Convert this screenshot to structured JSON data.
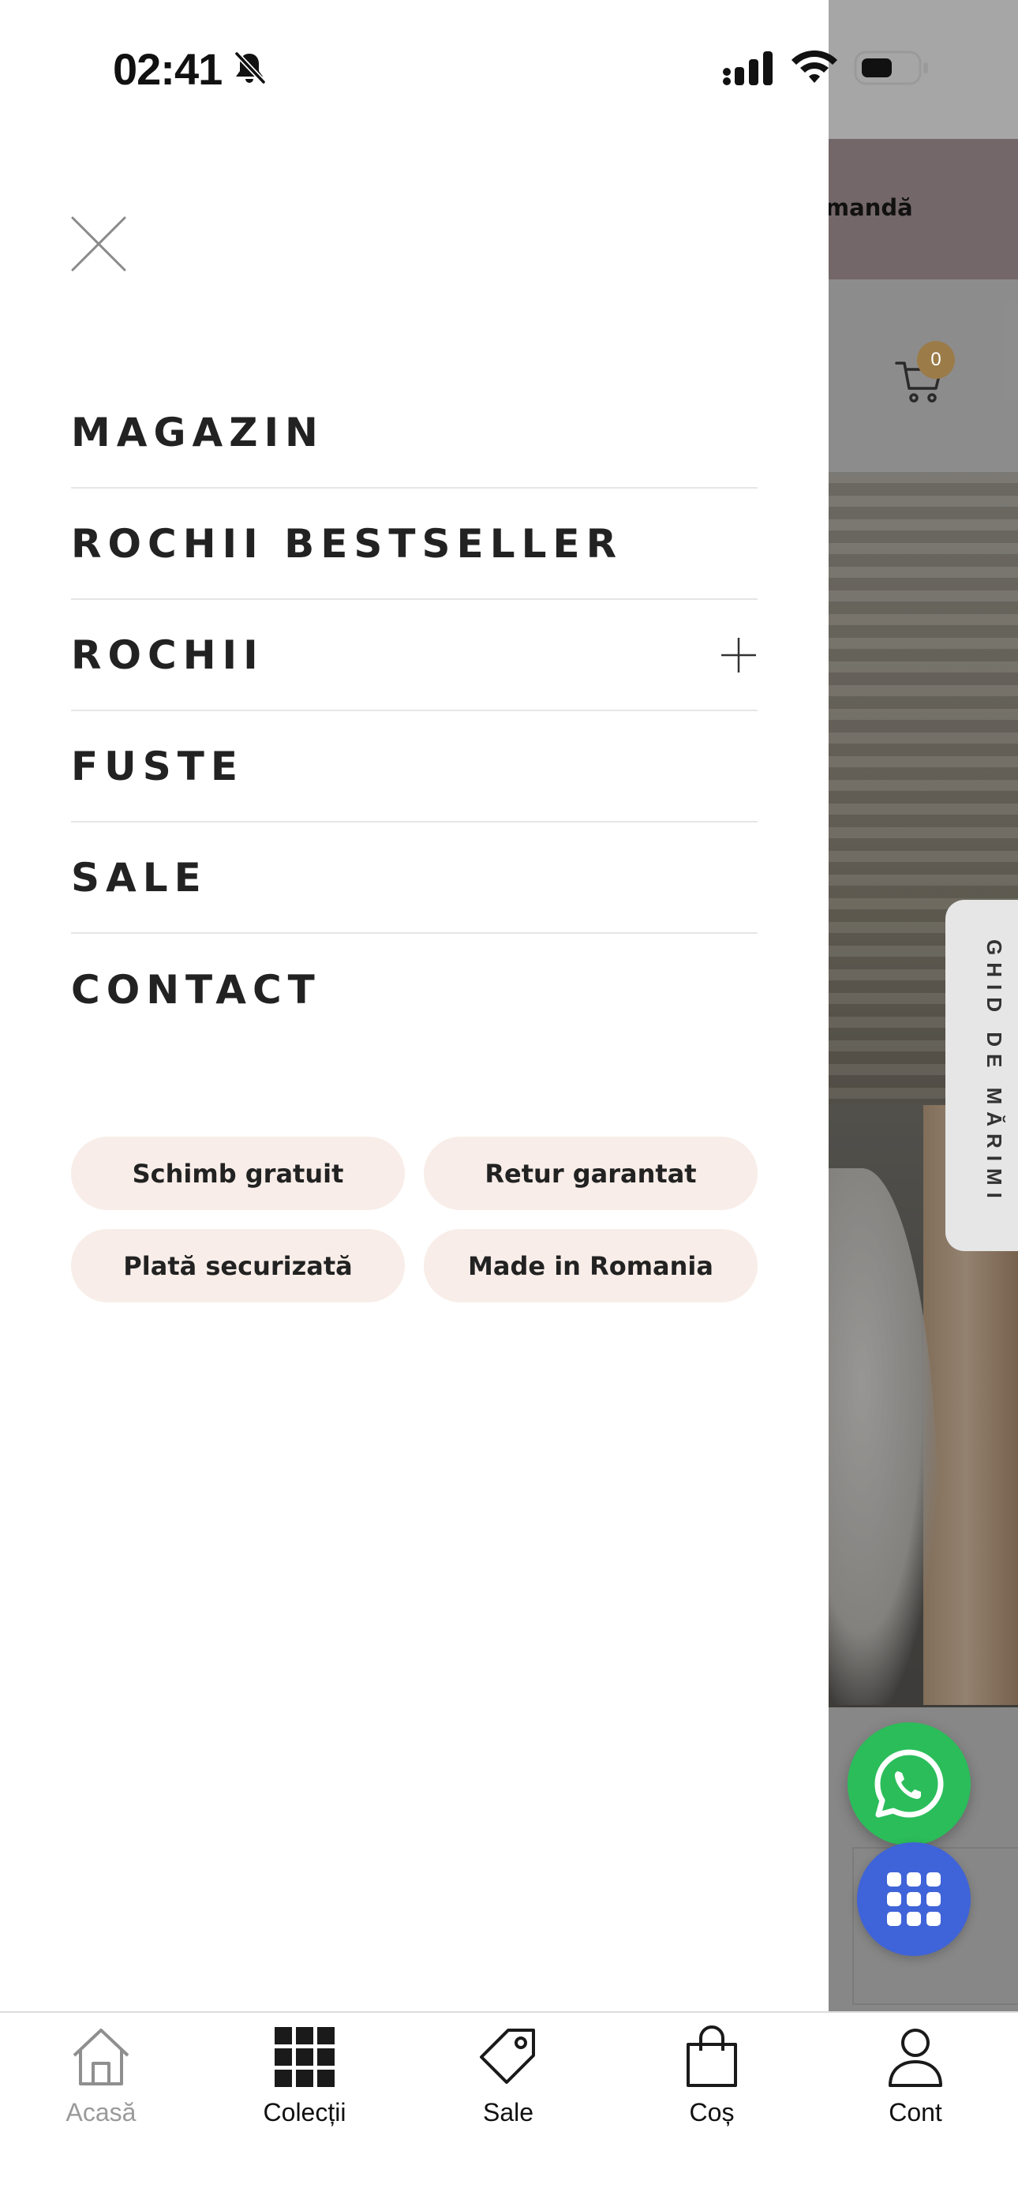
{
  "status_bar": {
    "time": "02:41"
  },
  "background": {
    "announcement_partial": "omandă",
    "cart_count": "0",
    "size_guide_label": "GHID DE MĂRIMI"
  },
  "menu": {
    "items": [
      {
        "label": "MAGAZIN"
      },
      {
        "label": "ROCHII BESTSELLER"
      },
      {
        "label": "ROCHII",
        "expandable": true
      },
      {
        "label": "FUSTE"
      },
      {
        "label": "SALE"
      },
      {
        "label": "CONTACT"
      }
    ],
    "badges": [
      "Schimb gratuit",
      "Retur garantat",
      "Plată securizată",
      "Made in Romania"
    ]
  },
  "tabbar": {
    "items": [
      {
        "label": "Acasă",
        "icon": "home-icon",
        "active": false
      },
      {
        "label": "Colecții",
        "icon": "grid-icon",
        "active": true
      },
      {
        "label": "Sale",
        "icon": "tag-icon",
        "active": true
      },
      {
        "label": "Coș",
        "icon": "bag-icon",
        "active": true
      },
      {
        "label": "Cont",
        "icon": "user-icon",
        "active": true
      }
    ]
  },
  "colors": {
    "badge_bg": "#f8ede8",
    "whatsapp": "#2bbd5a",
    "apps_button": "#3f63d8",
    "cart_badge": "#9b7b47"
  }
}
